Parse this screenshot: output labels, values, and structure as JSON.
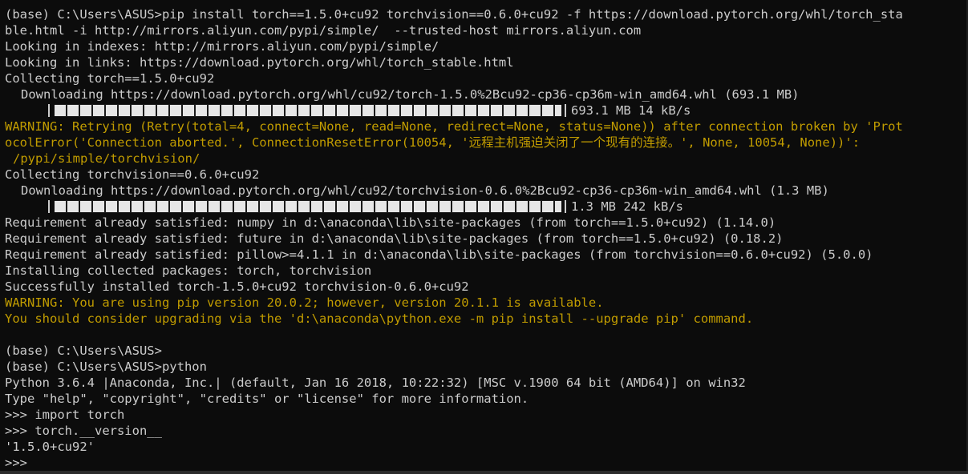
{
  "terminal": {
    "lines": [
      "(base) C:\\Users\\ASUS>pip install torch==1.5.0+cu92 torchvision==0.6.0+cu92 -f https://download.pytorch.org/whl/torch_sta",
      "ble.html -i http://mirrors.aliyun.com/pypi/simple/  --trusted-host mirrors.aliyun.com",
      "Looking in indexes: http://mirrors.aliyun.com/pypi/simple/",
      "Looking in links: https://download.pytorch.org/whl/torch_stable.html",
      "Collecting torch==1.5.0+cu92",
      "Downloading https://download.pytorch.org/whl/cu92/torch-1.5.0%2Bcu92-cp36-cp36m-win_amd64.whl (693.1 MB)",
      "WARNING: Retrying (Retry(total=4, connect=None, read=None, redirect=None, status=None)) after connection broken by 'Prot",
      "ocolError('Connection aborted.', ConnectionResetError(10054, '远程主机强迫关闭了一个现有的连接。', None, 10054, None))':",
      "/pypi/simple/torchvision/",
      "Collecting torchvision==0.6.0+cu92",
      "Downloading https://download.pytorch.org/whl/cu92/torchvision-0.6.0%2Bcu92-cp36-cp36m-win_amd64.whl (1.3 MB)",
      "Requirement already satisfied: numpy in d:\\anaconda\\lib\\site-packages (from torch==1.5.0+cu92) (1.14.0)",
      "Requirement already satisfied: future in d:\\anaconda\\lib\\site-packages (from torch==1.5.0+cu92) (0.18.2)",
      "Requirement already satisfied: pillow>=4.1.1 in d:\\anaconda\\lib\\site-packages (from torchvision==0.6.0+cu92) (5.0.0)",
      "Installing collected packages: torch, torchvision",
      "Successfully installed torch-1.5.0+cu92 torchvision-0.6.0+cu92",
      "WARNING: You are using pip version 20.0.2; however, version 20.1.1 is available.",
      "You should consider upgrading via the 'd:\\anaconda\\python.exe -m pip install --upgrade pip' command.",
      "(base) C:\\Users\\ASUS>",
      "(base) C:\\Users\\ASUS>python",
      "Python 3.6.4 |Anaconda, Inc.| (default, Jan 16 2018, 10:22:32) [MSC v.1900 64 bit (AMD64)] on win32",
      "Type \"help\", \"copyright\", \"credits\" or \"license\" for more information.",
      ">>> import torch",
      ">>> torch.__version__",
      "'1.5.0+cu92'",
      ">>>"
    ],
    "progress": [
      {
        "meta": "693.1 MB 14 kB/s",
        "fraction": 1.0
      },
      {
        "meta": "1.3 MB 242 kB/s",
        "fraction": 1.0
      }
    ]
  },
  "colors": {
    "background": "#0c0c0c",
    "text": "#cccccc",
    "warning": "#c19c00"
  }
}
